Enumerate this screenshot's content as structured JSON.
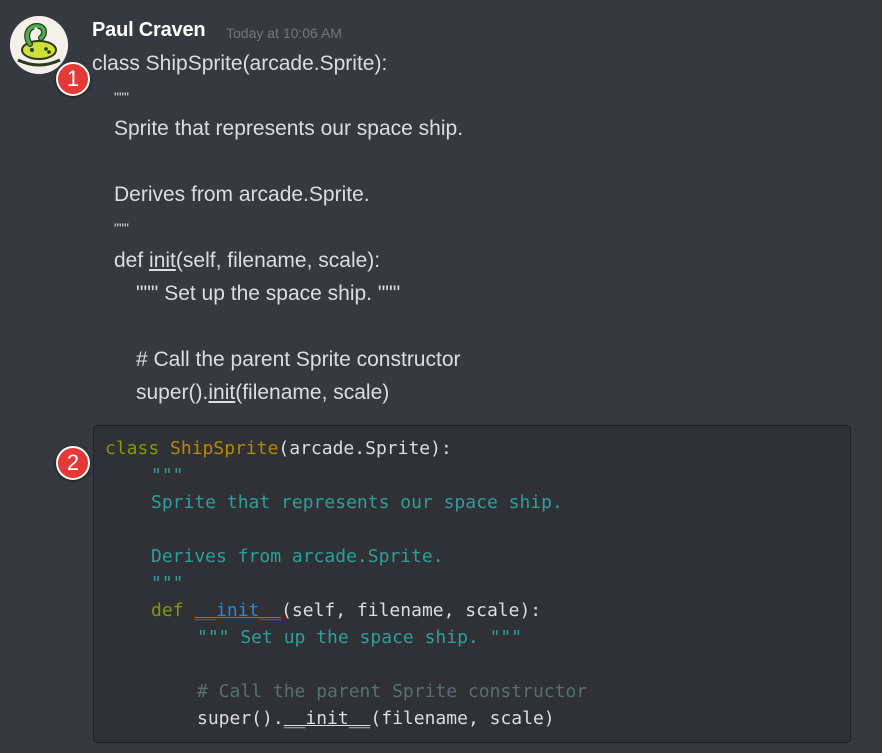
{
  "author": {
    "name": "Paul Craven",
    "timestamp": "Today at 10:06 AM"
  },
  "annotations": {
    "badge1": "1",
    "badge2": "2"
  },
  "message": {
    "lines": {
      "l1": "class ShipSprite(arcade.Sprite):",
      "l2": "\"\"\"",
      "l3": "Sprite that represents our space ship.",
      "l4": "Derives from arcade.Sprite.",
      "l5": "\"\"\"",
      "l6_pre": "def ",
      "l6_init": "init",
      "l6_post": "(self, filename, scale):",
      "l7": "\"\"\" Set up the space ship. \"\"\"",
      "l8": "# Call the parent Sprite constructor",
      "l9_pre": "super().",
      "l9_init": "init",
      "l9_post": "(filename, scale)"
    }
  },
  "code": {
    "c1_kw": "class",
    "c1_cls": "ShipSprite",
    "c1_rest": "(arcade.Sprite):",
    "c2": "\"\"\"",
    "c3": "Sprite that represents our space ship.",
    "c4": "Derives from arcade.Sprite.",
    "c5": "\"\"\"",
    "c6_kw": "def",
    "c6_fn": "__init__",
    "c6_rest": "(self, filename, scale):",
    "c7": "\"\"\" Set up the space ship. \"\"\"",
    "c8": "# Call the parent Sprite constructor",
    "c9_pre": "super().",
    "c9_init": "__init__",
    "c9_post": "(filename, scale)"
  },
  "colors": {
    "background": "#36393f",
    "codeblock": "#2f3136",
    "keyword": "#859900",
    "classname": "#b58900",
    "function": "#268bd2",
    "string": "#2aa198",
    "comment": "#586e75",
    "badge": "#e53935"
  }
}
